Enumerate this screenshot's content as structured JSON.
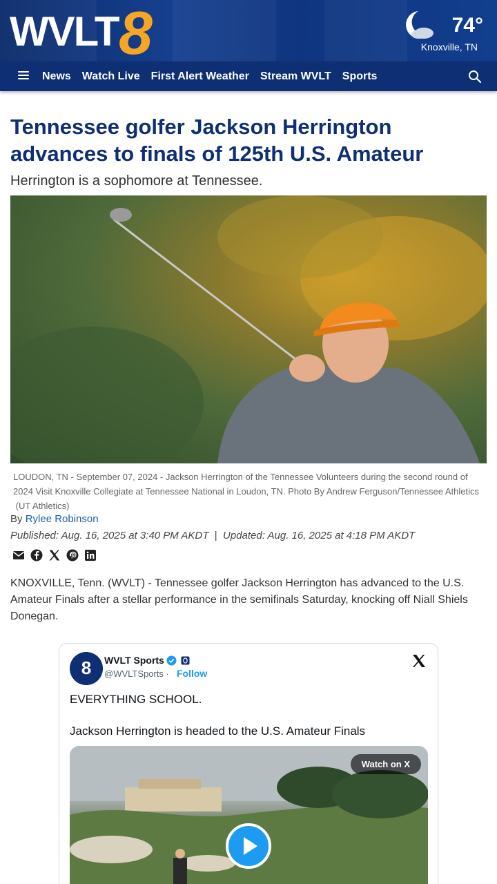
{
  "header": {
    "logo_text": "WVLT 8",
    "weather": {
      "temperature": "74°",
      "location": "Knoxville, TN",
      "icon": "partly-cloudy-icon"
    },
    "nav": {
      "items": [
        "News",
        "Watch Live",
        "First Alert Weather",
        "Stream WVLT",
        "Sports"
      ],
      "menu_icon": "hamburger-menu-icon",
      "search_icon": "search-icon"
    }
  },
  "article": {
    "headline": "Tennessee golfer Jackson Herrington advances to finals of 125th U.S. Amateur",
    "subhead": "Herrington is a sophomore at Tennessee.",
    "caption": "LOUDON, TN - September 07, 2024 - Jackson Herrington of the Tennessee Volunteers during the second round of 2024 Visit Knoxville Collegiate at Tennessee National in Loudon, TN. Photo By Andrew Ferguson/Tennessee Athletics",
    "caption_credit": "(UT Athletics)",
    "byline_prefix": "By",
    "author": "Rylee Robinson",
    "published_label": "Published",
    "published": "Aug. 16, 2025 at 3:40 PM AKDT",
    "updated_label": "Updated",
    "updated": "Aug. 16, 2025 at 4:18 PM AKDT",
    "separator": "|",
    "share_icons": [
      "email-icon",
      "facebook-icon",
      "x-icon",
      "pinterest-icon",
      "linkedin-icon"
    ],
    "body": "KNOXVILLE, Tenn. (WVLT) - Tennessee golfer Jackson Herrington has advanced to the U.S. Amateur Finals after a stellar performance in the semifinals Saturday, knocking off Niall Shiels Donegan."
  },
  "embed": {
    "account_name": "WVLT Sports",
    "handle": "@WVLTSports",
    "dot": "·",
    "follow_label": "Follow",
    "text_line1": "EVERYTHING SCHOOL.",
    "text_line2": "Jackson Herrington is headed to the U.S. Amateur Finals",
    "watch_label": "Watch on X",
    "colors": {
      "accent": "#1d9bf0"
    }
  },
  "colors": {
    "brand_navy": "#0e2f73",
    "logo_orange": "#f5a623",
    "link": "#1a5fb4"
  }
}
